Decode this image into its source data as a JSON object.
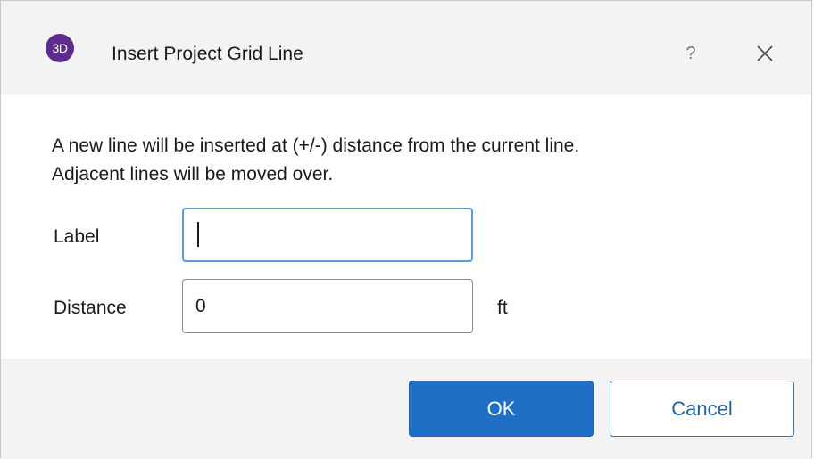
{
  "dialog": {
    "app_icon_text": "3D",
    "title": "Insert Project Grid Line",
    "help_glyph": "?",
    "description_line1": "A new line will be inserted at (+/-) distance from the current line.",
    "description_line2": "Adjacent lines will be moved over.",
    "fields": {
      "label": {
        "label": "Label",
        "value": ""
      },
      "distance": {
        "label": "Distance",
        "value": "0",
        "unit": "ft"
      }
    },
    "buttons": {
      "ok_label": "OK",
      "cancel_label": "Cancel"
    }
  },
  "icons": {
    "app": "app-3d-icon",
    "help": "help-icon",
    "close": "close-icon"
  },
  "colors": {
    "accent": "#1f6fc7",
    "app_icon_bg": "#5e2b8e",
    "focus_border": "#5b9ad8",
    "chrome_bg": "#f3f3f3"
  }
}
